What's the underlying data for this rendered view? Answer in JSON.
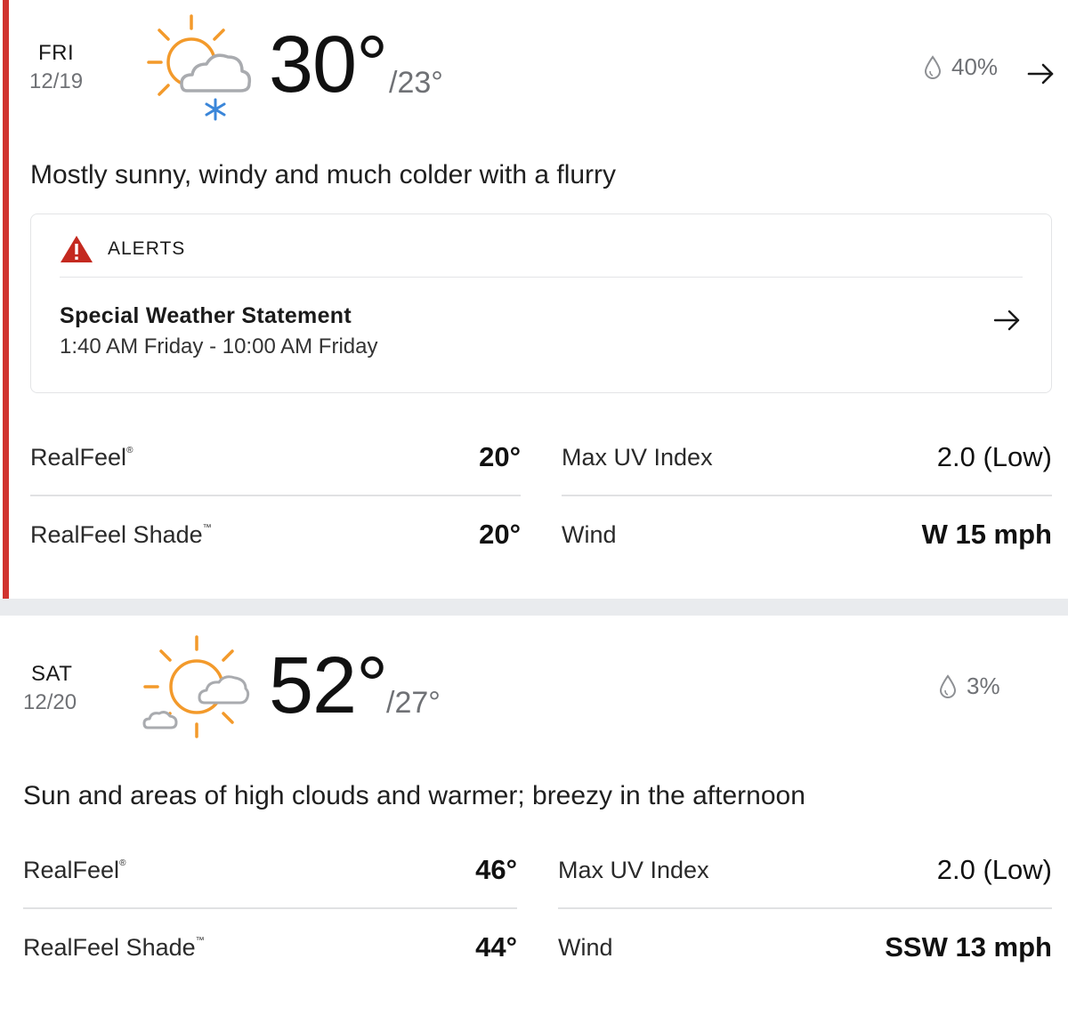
{
  "days": [
    {
      "day": "FRI",
      "date": "12/19",
      "icon": "sun-cloud-flurry-icon",
      "high": "30°",
      "low": "/23°",
      "precip": "40%",
      "phrase": "Mostly sunny, windy and much colder with a flurry",
      "alerts": {
        "heading": "ALERTS",
        "items": [
          {
            "title": "Special Weather Statement",
            "time": "1:40 AM Friday - 10:00 AM Friday"
          }
        ]
      },
      "stats": {
        "realfeel_label": "RealFeel",
        "realfeel_mark": "®",
        "realfeel": "20°",
        "realfeel_shade_label": "RealFeel Shade",
        "realfeel_shade_mark": "™",
        "realfeel_shade": "20°",
        "uv_label": "Max UV Index",
        "uv": "2.0 (Low)",
        "wind_label": "Wind",
        "wind": "W 15 mph"
      }
    },
    {
      "day": "SAT",
      "date": "12/20",
      "icon": "sun-high-clouds-icon",
      "high": "52°",
      "low": "/27°",
      "precip": "3%",
      "phrase": "Sun and areas of high clouds and warmer; breezy in the afternoon",
      "stats": {
        "realfeel_label": "RealFeel",
        "realfeel_mark": "®",
        "realfeel": "46°",
        "realfeel_shade_label": "RealFeel Shade",
        "realfeel_shade_mark": "™",
        "realfeel_shade": "44°",
        "uv_label": "Max UV Index",
        "uv": "2.0 (Low)",
        "wind_label": "Wind",
        "wind": "SSW 13 mph"
      }
    }
  ],
  "colors": {
    "accent": "#d1332f",
    "sun": "#f39a2b",
    "snow": "#3b86d9",
    "alert": "#c4291f"
  }
}
